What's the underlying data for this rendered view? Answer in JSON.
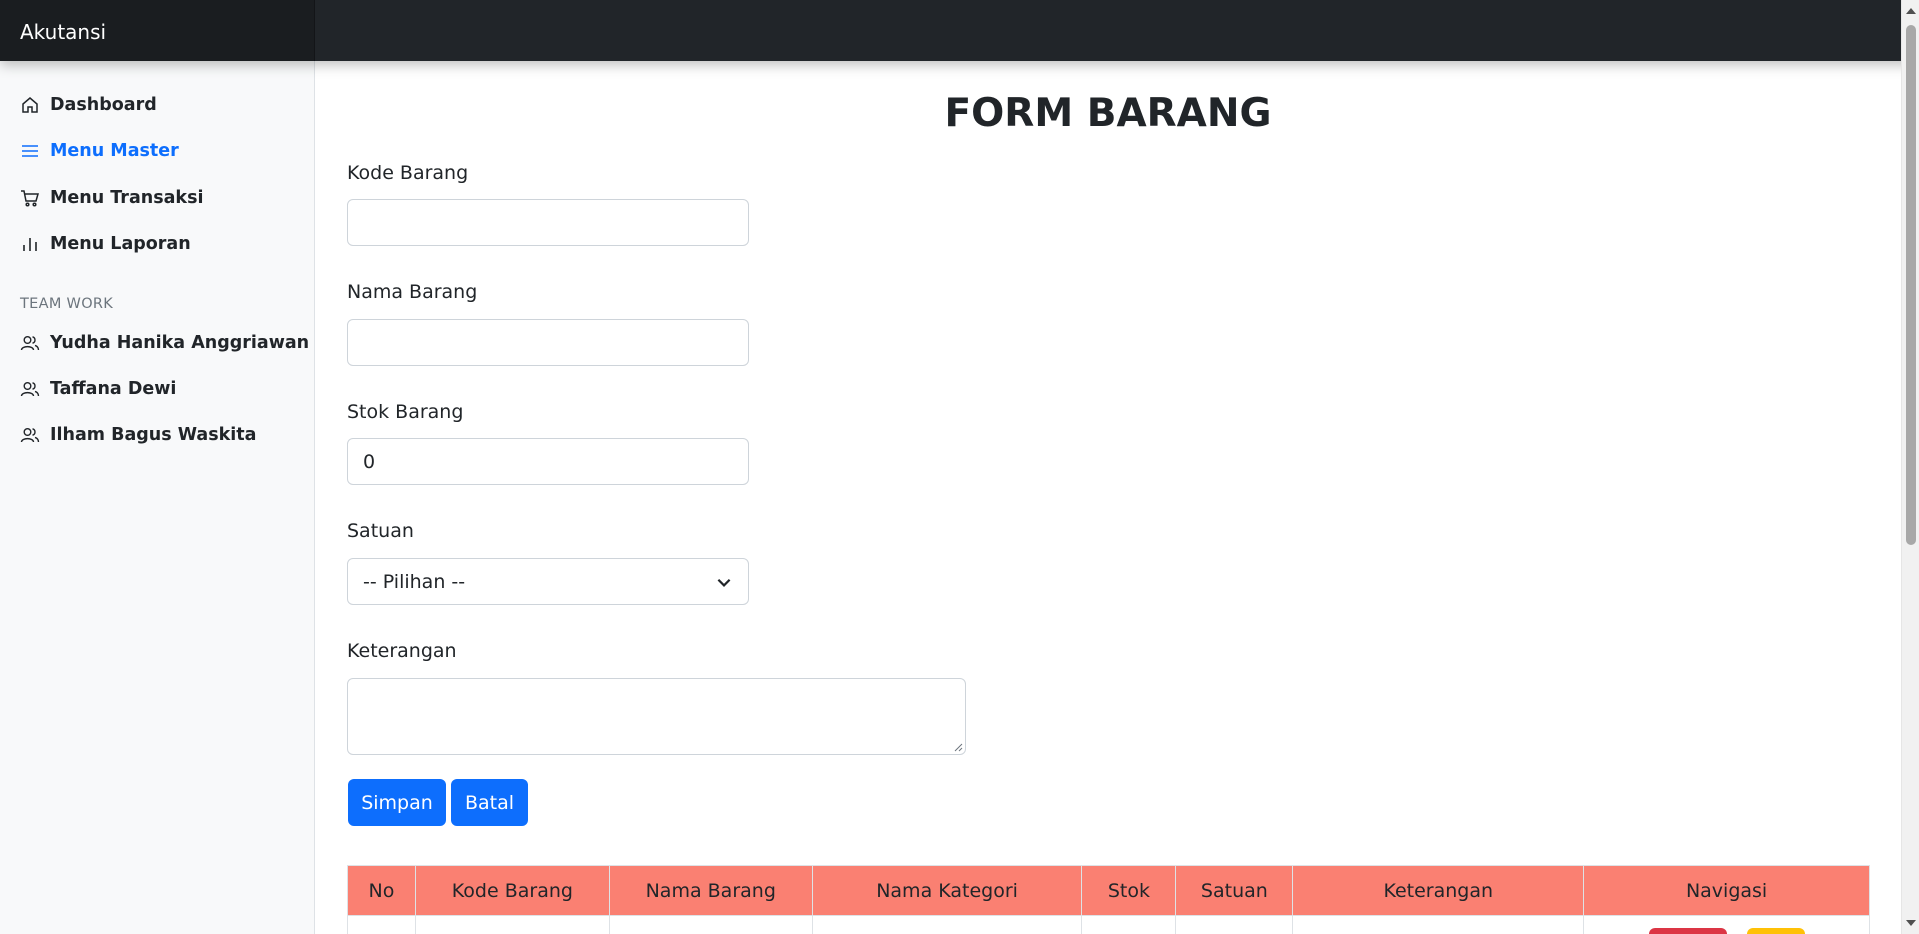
{
  "app": {
    "brand": "Akutansi"
  },
  "sidebar": {
    "items": [
      {
        "label": "Dashboard",
        "icon": "home-icon"
      },
      {
        "label": "Menu Master",
        "icon": "menu-icon",
        "active": true
      },
      {
        "label": "Menu Transaksi",
        "icon": "cart-icon"
      },
      {
        "label": "Menu Laporan",
        "icon": "bar-chart-icon"
      }
    ],
    "team_heading": "TEAM WORK",
    "team": [
      {
        "label": "Yudha Hanika Anggriawan",
        "icon": "users-icon"
      },
      {
        "label": "Taffana Dewi",
        "icon": "users-icon"
      },
      {
        "label": "Ilham Bagus Waskita",
        "icon": "users-icon"
      }
    ]
  },
  "form": {
    "title": "FORM BARANG",
    "kode_label": "Kode Barang",
    "kode_value": "",
    "nama_label": "Nama Barang",
    "nama_value": "",
    "stok_label": "Stok Barang",
    "stok_value": "0",
    "satuan_label": "Satuan",
    "satuan_selected": "-- Pilihan --",
    "keterangan_label": "Keterangan",
    "keterangan_value": "",
    "save_label": "Simpan",
    "cancel_label": "Batal"
  },
  "table": {
    "headers": [
      "No",
      "Kode Barang",
      "Nama Barang",
      "Nama Kategori",
      "Stok",
      "Satuan",
      "Keterangan",
      "Navigasi"
    ]
  },
  "colors": {
    "topbar": "#212529",
    "accent": "#0d6efd",
    "table_header": "#fa8072",
    "delete": "#dc3545",
    "edit": "#ffc107"
  }
}
